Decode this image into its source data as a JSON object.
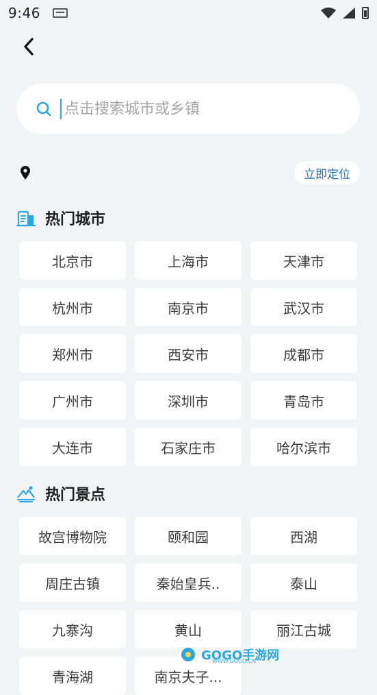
{
  "status_bar": {
    "time": "9:46",
    "icons": [
      "keyboard-icon",
      "wifi-icon",
      "signal-icon",
      "battery-charging-icon"
    ]
  },
  "nav": {
    "back_icon": "back-arrow-icon"
  },
  "search": {
    "placeholder": "点击搜索城市或乡镇",
    "value": "",
    "icon": "search-icon"
  },
  "location": {
    "icon": "location-pin-icon",
    "current": "",
    "locate_button": "立即定位"
  },
  "hot_cities": {
    "title": "热门城市",
    "icon": "building-icon",
    "items": [
      "北京市",
      "上海市",
      "天津市",
      "杭州市",
      "南京市",
      "武汉市",
      "郑州市",
      "西安市",
      "成都市",
      "广州市",
      "深圳市",
      "青岛市",
      "大连市",
      "石家庄市",
      "哈尔滨市"
    ]
  },
  "hot_spots": {
    "title": "热门景点",
    "icon": "mountain-scenery-icon",
    "items": [
      "故宫博物院",
      "颐和园",
      "西湖",
      "周庄古镇",
      "秦始皇兵..",
      "泰山",
      "九寨沟",
      "黄山",
      "丽江古城",
      "青海湖",
      "南京夫子..."
    ]
  },
  "watermark": {
    "text": "GOGO手游网",
    "subtext": "WWW.GOGO.CN"
  },
  "colors": {
    "background": "#F2F3F5",
    "accent": "#2AA6E0",
    "chip_text": "#2B6FB8"
  }
}
